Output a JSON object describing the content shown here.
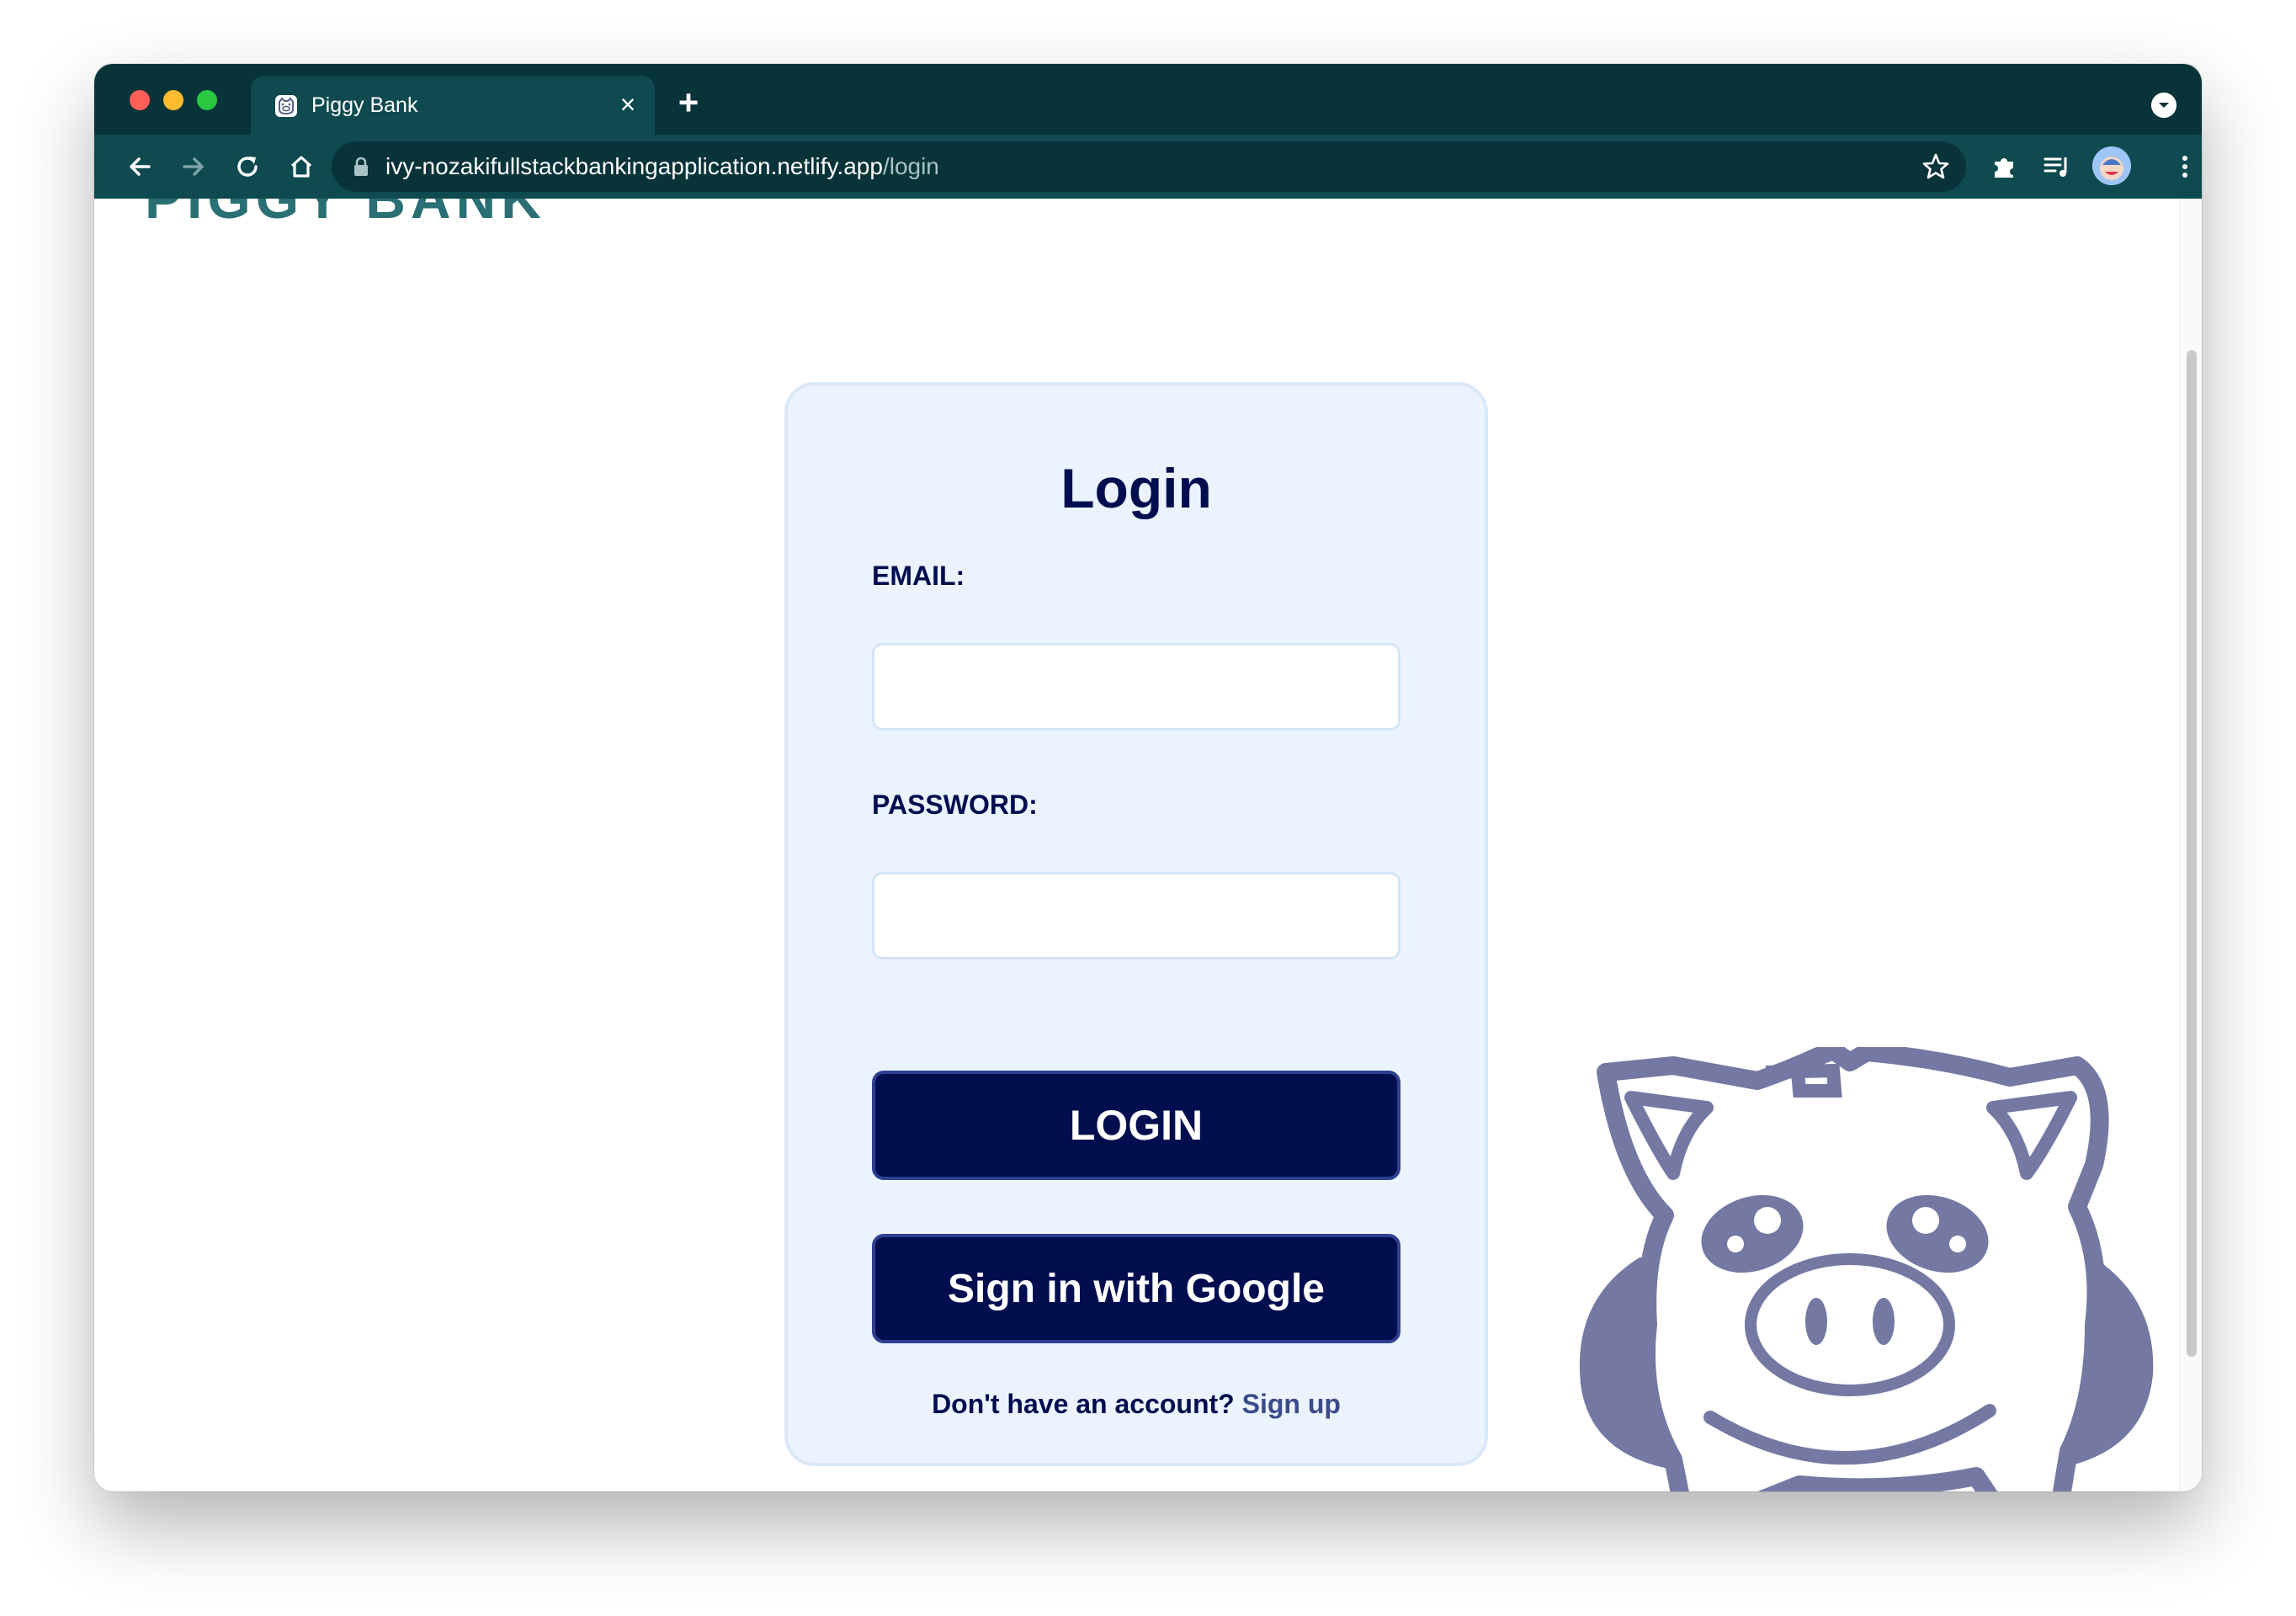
{
  "browser": {
    "tab_title": "Piggy Bank",
    "url_host": "ivy-nozakifullstackbankingapplication.netlify.app",
    "url_path": "/login"
  },
  "page": {
    "logo_partial": "PIGGY BANK"
  },
  "login": {
    "title": "Login",
    "email_label": "EMAIL:",
    "email_value": "",
    "password_label": "PASSWORD:",
    "password_value": "",
    "login_button": "LOGIN",
    "google_button": "Sign in with Google",
    "signup_prompt": "Don't have an account?",
    "signup_link": "Sign up"
  },
  "colors": {
    "browser_frame": "#083338",
    "card_background": "#ebf4fe",
    "primary_navy": "#000d4f",
    "pig_outline": "#7479a3"
  }
}
